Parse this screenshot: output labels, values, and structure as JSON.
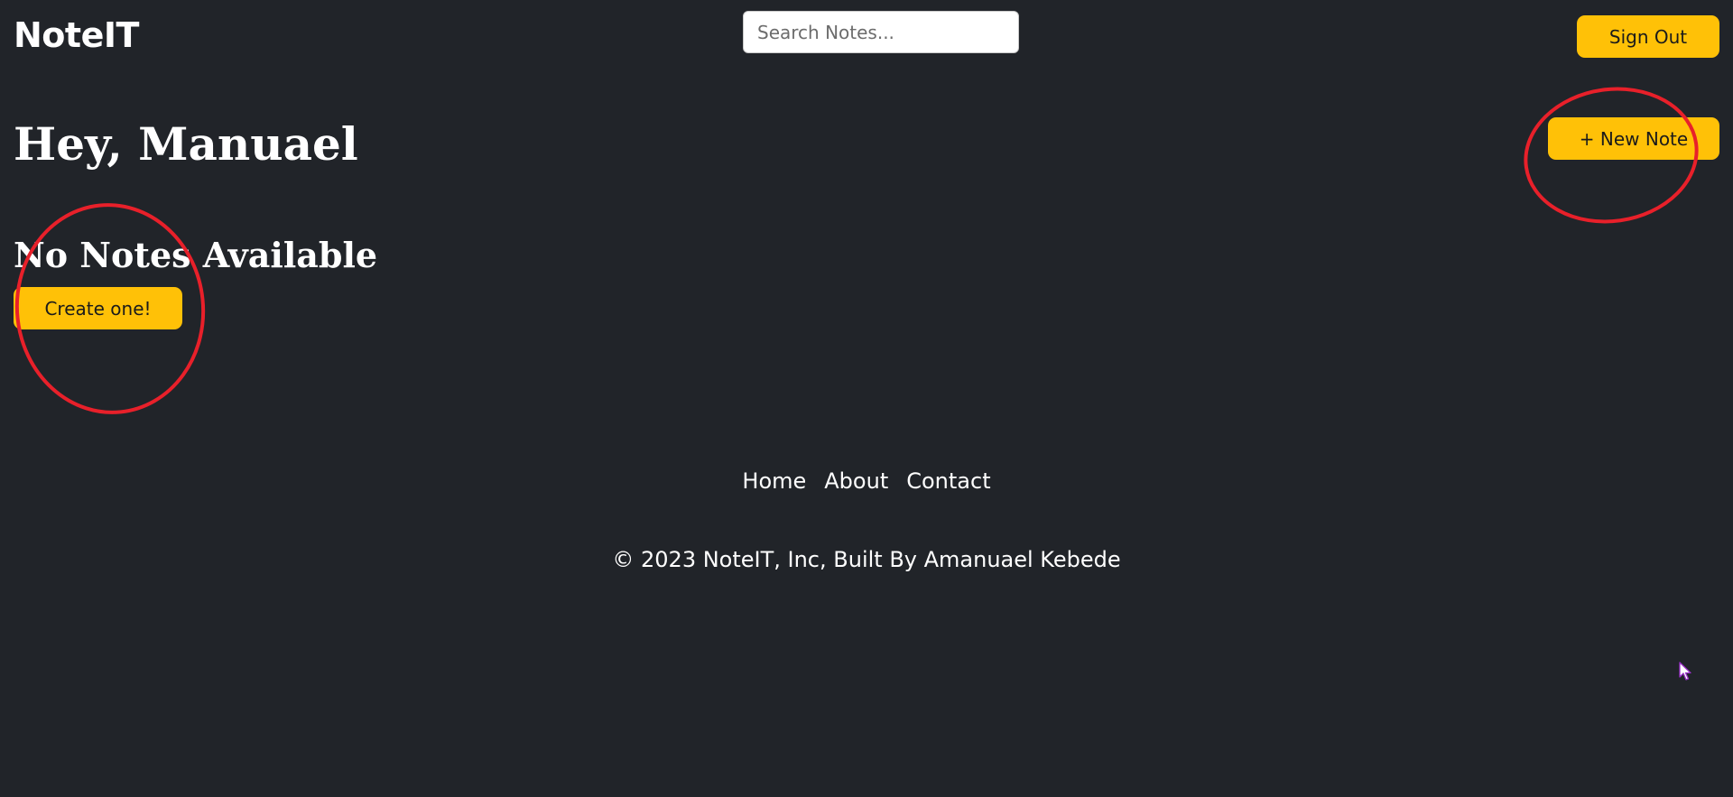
{
  "header": {
    "logo": "NoteIT",
    "search_placeholder": "Search Notes...",
    "sign_out_label": "Sign Out"
  },
  "main": {
    "greeting": "Hey, Manuael",
    "new_note_label": "+ New Note",
    "empty_heading": "No Notes Available",
    "create_label": "Create one!"
  },
  "footer": {
    "links": [
      "Home",
      "About",
      "Contact"
    ],
    "copyright": "© 2023 NoteIT, Inc, Built By Amanuael Kebede"
  },
  "colors": {
    "background": "#212429",
    "accent": "#ffc107",
    "annotation": "#e8202a"
  },
  "icons": {
    "cursor": "mouse-pointer-icon"
  }
}
